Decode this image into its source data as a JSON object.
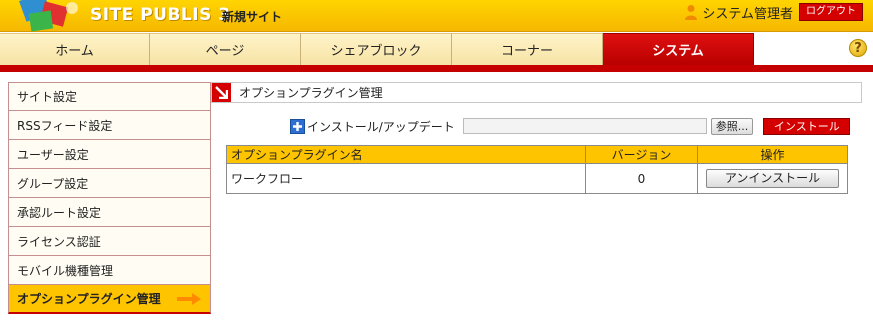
{
  "header": {
    "logo": "SITE PUBLIS 3",
    "site_name": "新規サイト",
    "user_name": "システム管理者",
    "logout_label": "ログアウト"
  },
  "nav": {
    "tabs": [
      {
        "label": "ホーム",
        "active": false
      },
      {
        "label": "ページ",
        "active": false
      },
      {
        "label": "シェアブロック",
        "active": false
      },
      {
        "label": "コーナー",
        "active": false
      },
      {
        "label": "システム",
        "active": true
      }
    ],
    "help_icon": "?"
  },
  "sidebar": {
    "items": [
      {
        "label": "サイト設定"
      },
      {
        "label": "RSSフィード設定"
      },
      {
        "label": "ユーザー設定"
      },
      {
        "label": "グループ設定"
      },
      {
        "label": "承認ルート設定"
      },
      {
        "label": "ライセンス認証"
      },
      {
        "label": "モバイル機種管理"
      },
      {
        "label": "オプションプラグイン管理",
        "active": true
      }
    ]
  },
  "main": {
    "title": "オプションプラグイン管理",
    "install": {
      "label": "インストール/アップデート",
      "file_value": "",
      "browse_label": "参照...",
      "install_label": "インストール"
    },
    "table": {
      "headers": [
        "オプションプラグイン名",
        "バージョン",
        "操作"
      ],
      "rows": [
        {
          "name": "ワークフロー",
          "version": "0",
          "action": "アンインストール"
        }
      ]
    }
  },
  "colors": {
    "accent_red": "#c40000",
    "accent_yellow": "#ffc400"
  }
}
